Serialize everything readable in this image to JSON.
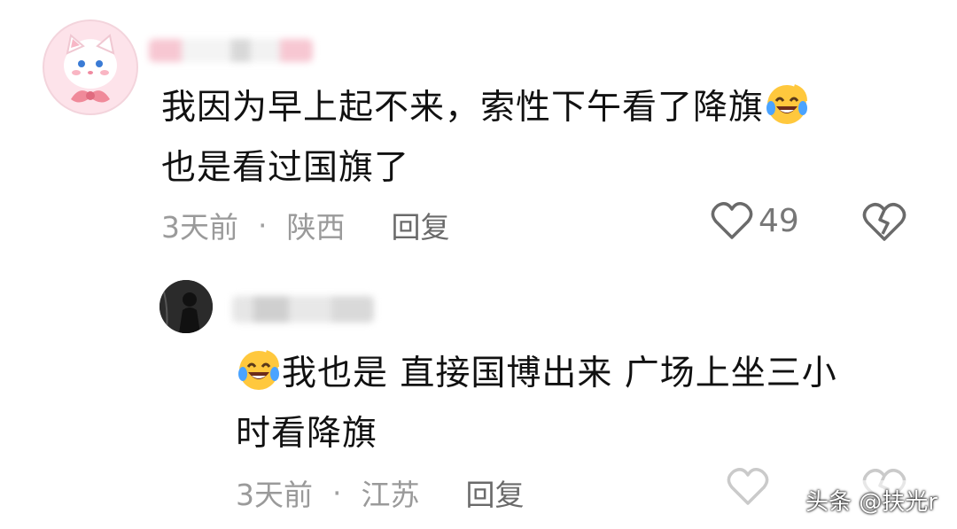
{
  "main_comment": {
    "avatar": "pink-cat-avatar",
    "text_line1": "我因为早上起不来，索性下午看了降旗",
    "emoji": "laughing-crying-emoji",
    "text_line2": "也是看过国旗了",
    "time": "3天前",
    "separator": "·",
    "location": "陕西",
    "reply_label": "回复",
    "like_count": "49",
    "like_icon": "heart-outline-icon",
    "dislike_icon": "broken-heart-icon"
  },
  "reply_comment": {
    "avatar": "dark-silhouette-avatar",
    "emoji": "laughing-crying-emoji",
    "text_line1": "我也是 直接国博出来 广场上坐三小",
    "text_line2": "时看降旗",
    "time": "3天前",
    "separator": "·",
    "location": "江苏",
    "reply_label": "回复"
  },
  "watermark": "头条 @扶光r"
}
